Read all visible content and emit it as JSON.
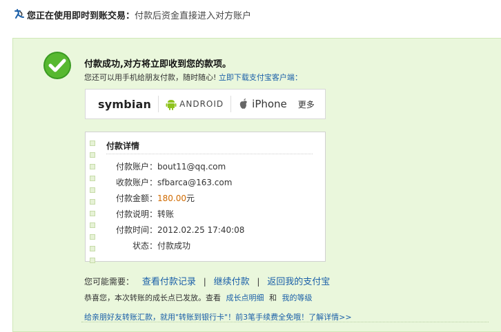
{
  "topbar": {
    "strong": "您正在使用即时到账交易：",
    "desc": "付款后资金直接进入对方账户"
  },
  "success": {
    "title": "付款成功,对方将立即收到您的款项。",
    "subtext": "您还可以用手机给朋友付款，随时随心!",
    "download_link": "立即下载支付宝客户端："
  },
  "platforms": {
    "symbian": "symbian",
    "android": "ANDROID",
    "iphone": "iPhone",
    "more": "更多"
  },
  "details": {
    "header": "付款详情",
    "rows": [
      {
        "label": "付款账户：",
        "value": "bout11@qq.com"
      },
      {
        "label": "收款账户：",
        "value": "sfbarca@163.com"
      },
      {
        "label": "付款金额：",
        "value": "180.00",
        "unit": "元"
      },
      {
        "label": "付款说明：",
        "value": "转账"
      },
      {
        "label": "付款时间：",
        "value": "2012.02.25 17:40:08"
      },
      {
        "label": "状态：",
        "value": "付款成功"
      }
    ]
  },
  "actions": {
    "prefix": "您可能需要：",
    "view_records": "查看付款记录",
    "continue_pay": "继续付款",
    "back_alipay": "返回我的支付宝",
    "separator": "|"
  },
  "growth": {
    "text": "恭喜您，本次转账的成长点已发放。查看",
    "detail_link": "成长点明细",
    "and": "和",
    "level_link": "我的等级"
  },
  "promo": {
    "text": "给亲朋好友转账汇款，就用\"转账到银行卡\"！前3笔手续费全免哦！了解详情>>"
  },
  "colors": {
    "accent_link": "#1a5fa8",
    "panel_bg": "#eaf7dc",
    "success_green": "#4caf30",
    "money": "#d06a00"
  },
  "icons": {
    "success": "checkmark-circle-icon",
    "brand": "alipay-logo-icon",
    "android": "android-robot-icon",
    "apple": "apple-logo-icon"
  }
}
